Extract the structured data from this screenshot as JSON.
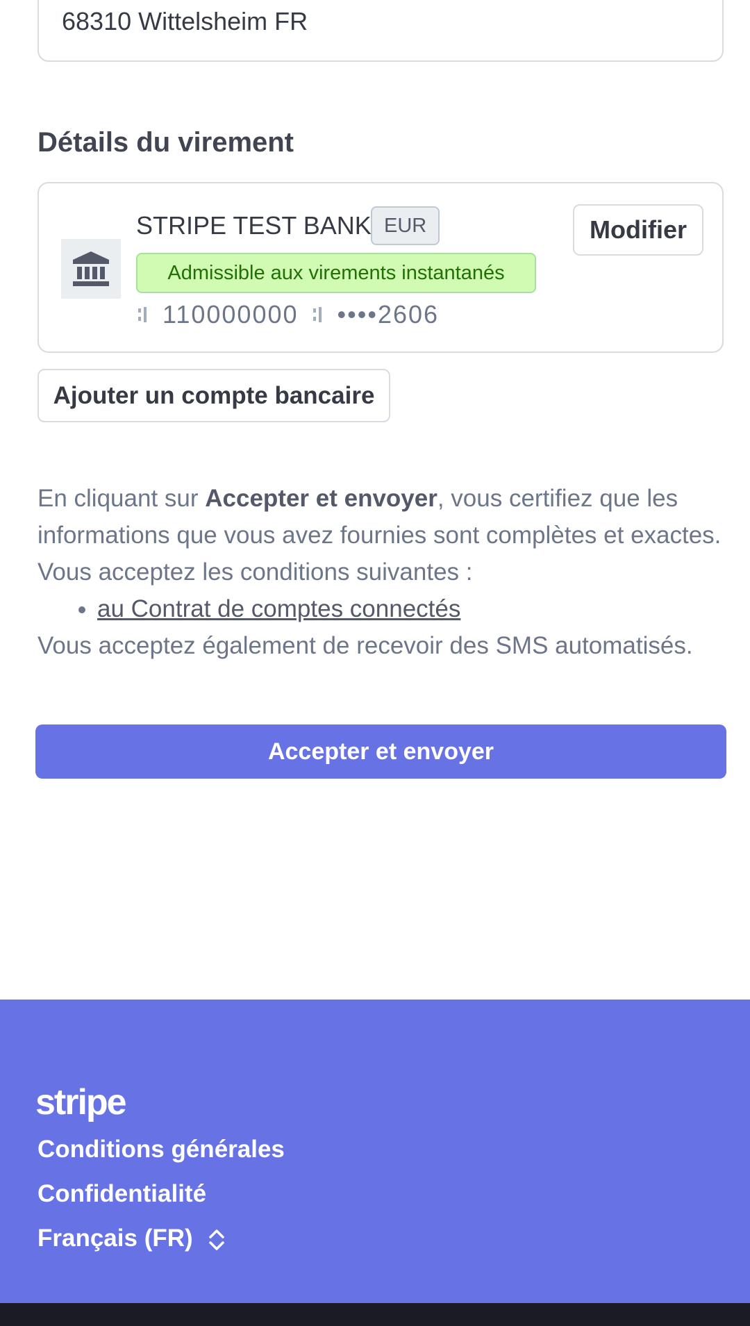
{
  "address": {
    "line": "68310 Wittelsheim FR"
  },
  "transfer": {
    "section_title": "Détails du virement",
    "bank_name": "STRIPE TEST BANK",
    "currency": "EUR",
    "instant_badge": "Admissible aux virements instantanés",
    "routing_number": "110000000",
    "account_masked": "••••2606",
    "modify_label": "Modifier",
    "icons": {
      "bank": "bank-building-icon",
      "separator": "routing-separator-icon"
    }
  },
  "add_bank": {
    "label": "Ajouter un compte bancaire"
  },
  "consent": {
    "prefix": "En cliquant sur ",
    "bold": "Accepter et envoyer",
    "suffix": ", vous certifiez que les informations que vous avez fournies sont complètes et exactes. Vous acceptez les conditions suivantes :",
    "link": "au Contrat de comptes connectés",
    "sms": "Vous acceptez également de recevoir des SMS automatisés."
  },
  "actions": {
    "accept_label": "Accepter et envoyer"
  },
  "footer": {
    "logo": "stripe",
    "terms": "Conditions générales",
    "privacy": "Confidentialité",
    "language": "Français (FR)",
    "language_icon": "chevron-up-down-icon"
  },
  "colors": {
    "brand": "#6772e5",
    "instant_bg": "#d1fab3",
    "instant_text": "#217005",
    "border": "#d8dbe0",
    "bottom_bar": "#1a1b25"
  }
}
